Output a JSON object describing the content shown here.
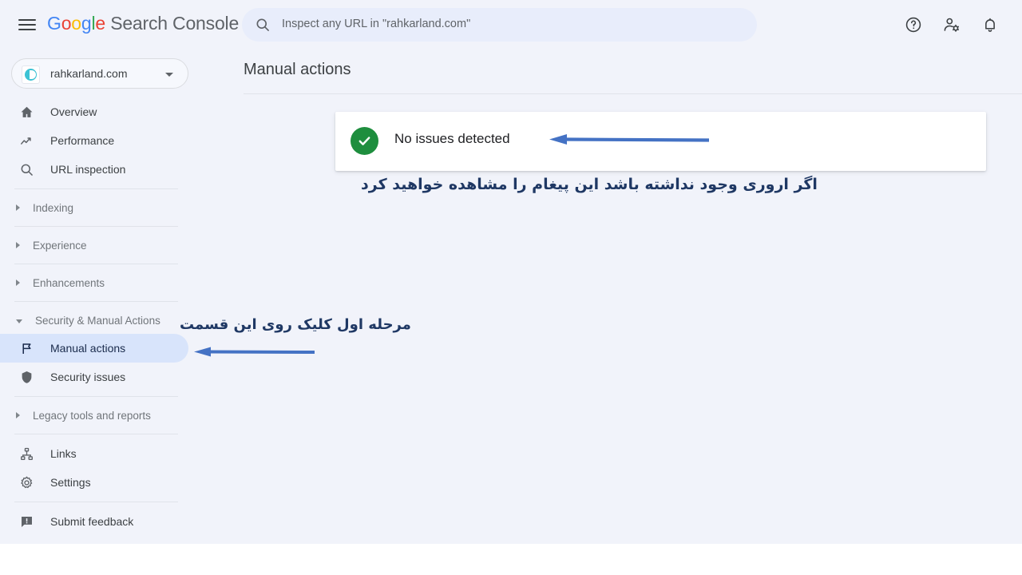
{
  "header": {
    "menu_icon": "hamburger-menu-icon",
    "brand_google": "Google",
    "brand_suffix": " Search Console",
    "search": {
      "icon": "search-icon",
      "placeholder": "Inspect any URL in \"rahkarland.com\""
    },
    "icons": [
      {
        "name": "help-icon",
        "title": "Help"
      },
      {
        "name": "account-settings-icon",
        "title": "Account settings"
      },
      {
        "name": "notifications-bell-icon",
        "title": "Notifications"
      }
    ]
  },
  "sidebar": {
    "property": {
      "label": "rahkarland.com",
      "favicon": "site-favicon-icon",
      "caret": "chevron-down-icon"
    },
    "items": [
      {
        "label": "Overview",
        "icon": "home-icon",
        "type": "item",
        "selected": false
      },
      {
        "label": "Performance",
        "icon": "trending-up-icon",
        "type": "item",
        "selected": false
      },
      {
        "label": "URL inspection",
        "icon": "search-icon",
        "type": "item",
        "selected": false
      },
      {
        "label": "Indexing",
        "icon": "chevron-right-icon",
        "type": "group",
        "expanded": false
      },
      {
        "label": "Experience",
        "icon": "chevron-right-icon",
        "type": "group",
        "expanded": false
      },
      {
        "label": "Enhancements",
        "icon": "chevron-right-icon",
        "type": "group",
        "expanded": false
      },
      {
        "label": "Security & Manual Actions",
        "icon": "chevron-down-icon",
        "type": "group",
        "expanded": true
      },
      {
        "label": "Manual actions",
        "icon": "flag-icon",
        "type": "item",
        "selected": true
      },
      {
        "label": "Security issues",
        "icon": "shield-icon",
        "type": "item",
        "selected": false
      },
      {
        "label": "Legacy tools and reports",
        "icon": "chevron-right-icon",
        "type": "group",
        "expanded": false
      },
      {
        "label": "Links",
        "icon": "links-hierarchy-icon",
        "type": "item",
        "selected": false
      },
      {
        "label": "Settings",
        "icon": "gear-icon",
        "type": "item",
        "selected": false
      },
      {
        "label": "Submit feedback",
        "icon": "feedback-icon",
        "type": "item",
        "selected": false
      }
    ]
  },
  "main": {
    "page_title": "Manual actions",
    "status_card": {
      "icon": "green-check-circle-icon",
      "text": "No issues detected"
    }
  },
  "annotations": [
    {
      "id": 1,
      "text": "اگر اروری وجود نداشته باشد این پیغام را مشاهده خواهید کرد",
      "arrow": "arrow-left"
    },
    {
      "id": 2,
      "text": "مرحله اول کلیک روی این قسمت",
      "arrow": "arrow-left"
    }
  ],
  "colors": {
    "background": "#f1f3fa",
    "card": "#ffffff",
    "selected_nav": "#d8e4fb",
    "success_green": "#1e8e3e",
    "annotation_blue": "#4472c4",
    "annotation_text": "#1f3864",
    "search_field": "#e8edfb",
    "google_blue": "#4285F4",
    "google_red": "#EA4335",
    "google_yellow": "#FBBC05",
    "google_green": "#34A853"
  }
}
